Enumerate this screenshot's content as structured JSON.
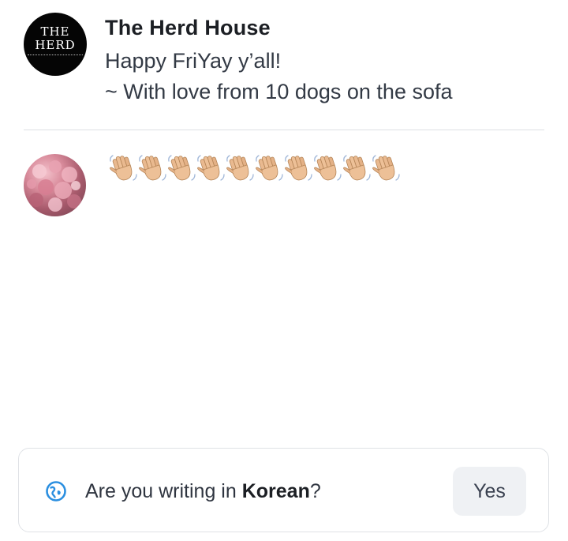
{
  "post": {
    "avatar_text_line1": "THE",
    "avatar_text_line2": "HERD",
    "author": "The Herd House",
    "lines": [
      "Happy FriYay y’all!",
      "~ With love from 10 dogs on the sofa"
    ]
  },
  "reply": {
    "avatar_icon": "pink-flower-photo",
    "emoji": "👋🏼",
    "emoji_count": 10
  },
  "language_prompt": {
    "icon": "globe-translate-icon",
    "text_before": "Are you writing in ",
    "language": "Korean",
    "text_after": "?",
    "yes_label": "Yes"
  },
  "colors": {
    "accent_blue": "#2b8fe0",
    "button_bg": "#eff1f4",
    "divider": "#dcdfe3"
  }
}
